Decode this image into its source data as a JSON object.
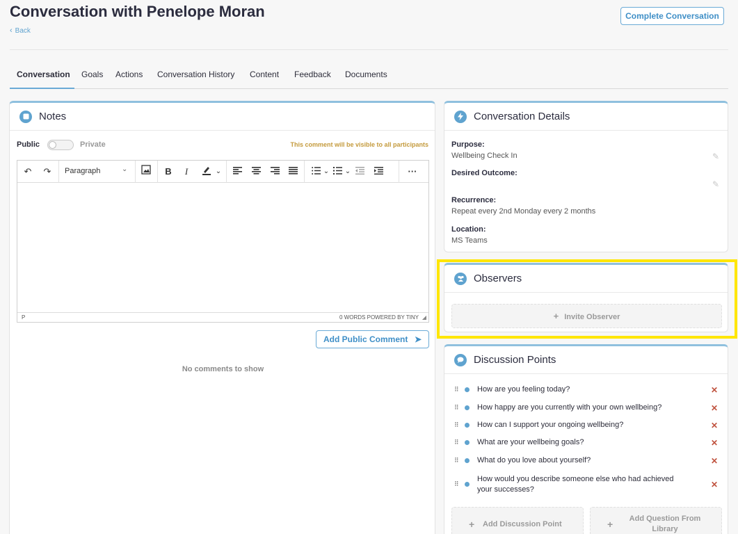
{
  "header": {
    "title": "Conversation with Penelope Moran",
    "back_label": "Back",
    "complete_label": "Complete Conversation"
  },
  "tabs": [
    {
      "label": "Conversation",
      "active": true
    },
    {
      "label": "Goals"
    },
    {
      "label": "Actions"
    },
    {
      "label": "Conversation History"
    },
    {
      "label": "Content"
    },
    {
      "label": "Feedback"
    },
    {
      "label": "Documents"
    }
  ],
  "notes": {
    "title": "Notes",
    "public_label": "Public",
    "private_label": "Private",
    "visibility_note": "This comment will be visible to all participants",
    "editor": {
      "block_format": "Paragraph",
      "status_path": "P",
      "word_count": "0 WORDS",
      "powered_by": "POWERED BY TINY"
    },
    "add_comment_label": "Add Public Comment",
    "empty_message": "No comments to show"
  },
  "details": {
    "title": "Conversation Details",
    "purpose_label": "Purpose:",
    "purpose_value": "Wellbeing Check In",
    "desired_outcome_label": "Desired Outcome:",
    "recurrence_label": "Recurrence:",
    "recurrence_value": "Repeat every 2nd Monday every 2 months",
    "location_label": "Location:",
    "location_value": "MS Teams"
  },
  "observers": {
    "title": "Observers",
    "invite_label": "Invite Observer"
  },
  "discussion": {
    "title": "Discussion Points",
    "items": [
      "How are you feeling today?",
      "How happy are you currently with your own wellbeing?",
      "How can I support your ongoing wellbeing?",
      "What are your wellbeing goals?",
      "What do you love about yourself?",
      "How would you describe someone else who had achieved your successes?"
    ],
    "add_point_label": "Add Discussion Point",
    "add_library_label": "Add Question From Library"
  },
  "colors": {
    "accent": "#5fa3cf",
    "highlight": "#ffe600",
    "remove": "#c0533f",
    "warning": "#c49a3c"
  }
}
